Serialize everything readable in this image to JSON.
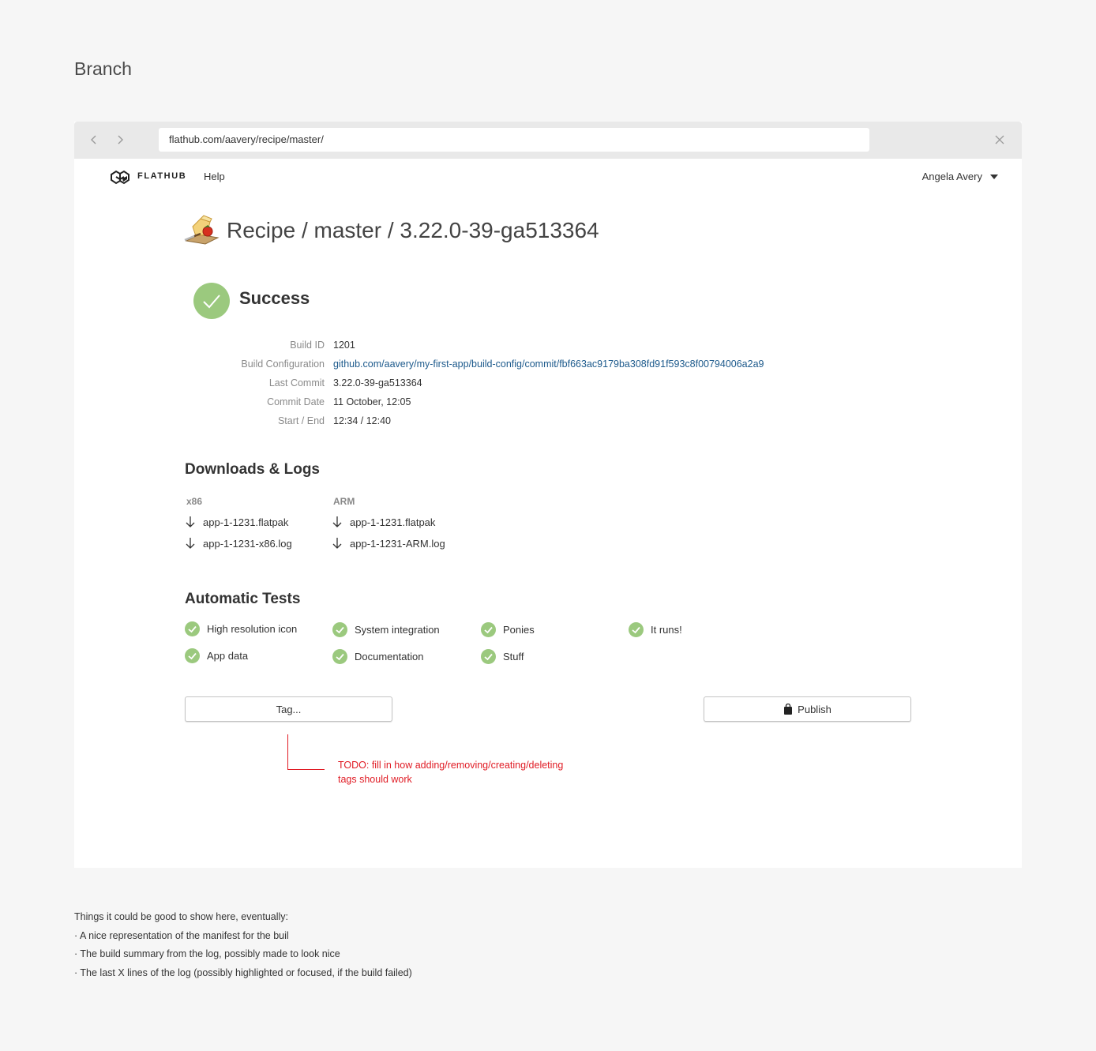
{
  "page": {
    "heading": "Branch"
  },
  "browser": {
    "url": "flathub.com/aavery/recipe/master/",
    "back_icon": "chevron-left-icon",
    "forward_icon": "chevron-right-icon",
    "close_icon": "close-icon"
  },
  "header": {
    "logo_text": "FLATHUB",
    "help_label": "Help",
    "user_name": "Angela Avery"
  },
  "build": {
    "title": "Recipe / master / 3.22.0-39-ga513364",
    "status": "Success",
    "status_color": "#9bc97e",
    "details": [
      {
        "label": "Build ID",
        "value": "1201"
      },
      {
        "label": "Build Configuration",
        "value": "github.com/aavery/my-first-app/build-config/commit/fbf663ac9179ba308fd91f593c8f00794006a2a9"
      },
      {
        "label": "Last Commit",
        "value": "3.22.0-39-ga513364"
      },
      {
        "label": "Commit Date",
        "value": "11 October, 12:05"
      },
      {
        "label": "Start / End",
        "value": "12:34 / 12:40"
      }
    ]
  },
  "downloads": {
    "title": "Downloads & Logs",
    "columns": [
      {
        "arch": "x86",
        "files": [
          "app-1-1231.flatpak",
          "app-1-1231-x86.log"
        ]
      },
      {
        "arch": "ARM",
        "files": [
          "app-1-1231.flatpak",
          "app-1-1231-ARM.log"
        ]
      }
    ]
  },
  "tests": {
    "title": "Automatic Tests",
    "items": [
      "High resolution icon",
      "App data",
      "System integration",
      "Documentation",
      "Ponies",
      "Stuff",
      "It runs!"
    ]
  },
  "actions": {
    "tag_label": "Tag...",
    "publish_label": "Publish"
  },
  "todo": {
    "line1": "TODO: fill in how adding/removing/creating/deleting",
    "line2": "tags should work"
  },
  "notes": {
    "intro": "Things it could be good to show here, eventually:",
    "bullets": [
      "· A nice representation of the manifest for the buil",
      "· The build summary from the log, possibly made to look nice",
      "· The last X lines of the log (possibly highlighted or focused, if the build failed)"
    ]
  }
}
